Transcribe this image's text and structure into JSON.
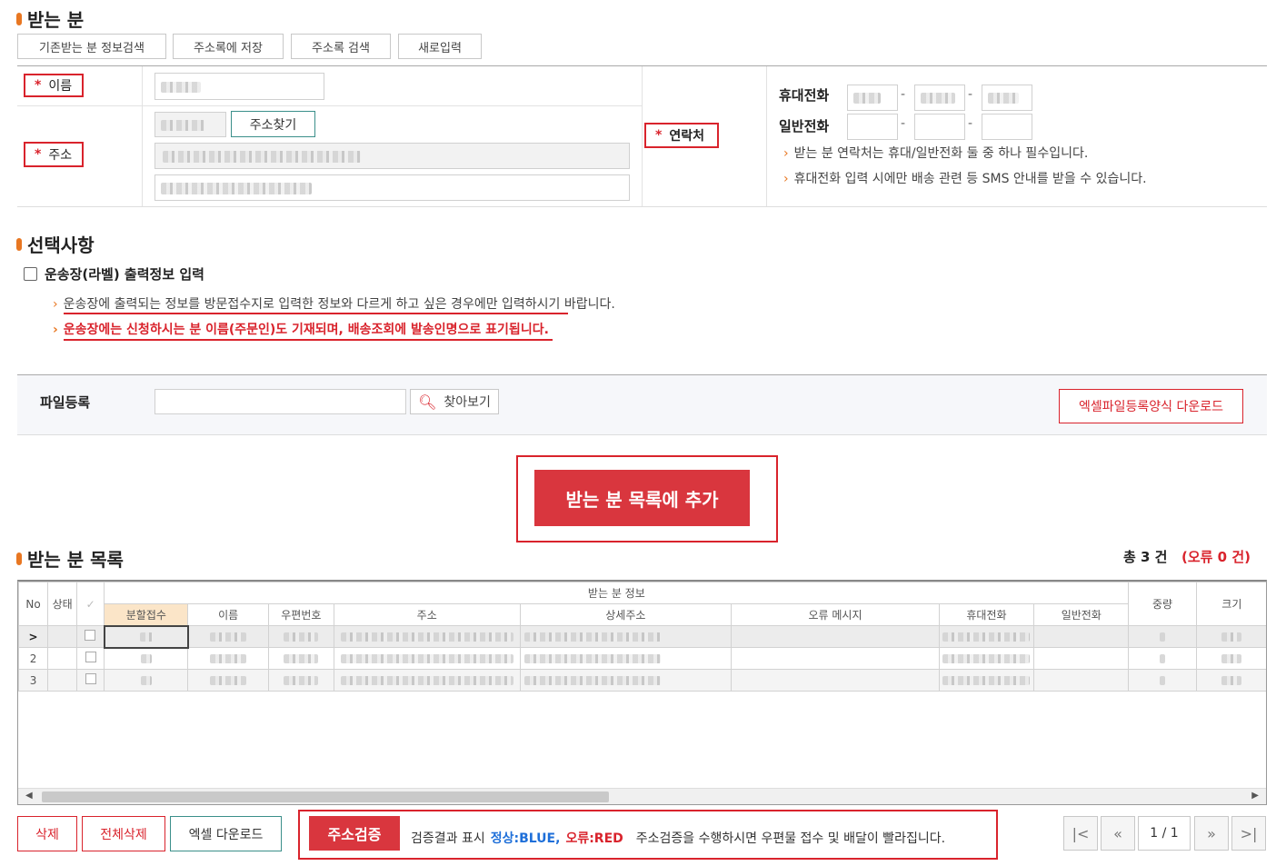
{
  "recipient": {
    "title": "받는 분",
    "buttons": [
      "기존받는 분 정보검색",
      "주소록에 저장",
      "주소록 검색",
      "새로입력"
    ],
    "name_label": "이름",
    "address_label": "주소",
    "address_search_btn": "주소찾기",
    "contact_label": "연락처",
    "mobile_label": "휴대전화",
    "phone_label": "일반전화",
    "dash": "-",
    "notes": [
      "받는 분 연락처는 휴대/일반전화 둘 중 하나 필수입니다.",
      "휴대전화 입력 시에만 배송 관련 등 SMS 안내를 받을 수 있습니다."
    ]
  },
  "options": {
    "title": "선택사항",
    "checkbox_label": "운송장(라벨) 출력정보 입력",
    "notes": [
      "운송장에 출력되는 정보를 방문접수지로 입력한 정보와 다르게 하고 싶은 경우에만 입력하시기 바랍니다.",
      "운송장에는 신청하시는 분 이름(주문인)도 기재되며, 배송조회에 발송인명으로 표기됩니다."
    ]
  },
  "file": {
    "label": "파일등록",
    "browse_btn": "찾아보기",
    "download_template_btn": "엑셀파일등록양식 다운로드"
  },
  "add_button": "받는 분 목록에 추가",
  "list": {
    "title": "받는 분 목록",
    "total": "총 3 건",
    "errors": "(오류 0 건)",
    "group_header": "받는 분 정보",
    "columns": {
      "no": "No",
      "status": "상태",
      "split": "분할접수",
      "name": "이름",
      "zip": "우편번호",
      "address": "주소",
      "detail": "상세주소",
      "error_msg": "오류 메시지",
      "mobile": "휴대전화",
      "phone": "일반전화",
      "weight": "중량",
      "size": "크기"
    },
    "rows": [
      {
        "no": ">"
      },
      {
        "no": "2"
      },
      {
        "no": "3"
      }
    ]
  },
  "footer": {
    "delete_btn": "삭제",
    "delete_all_btn": "전체삭제",
    "excel_download_btn": "엑셀 다운로드",
    "verify_btn": "주소검증",
    "result_label": "검증결과 표시",
    "normal_text": "정상:BLUE,",
    "error_text": "오류:RED",
    "verify_note": "주소검증을 수행하시면 우편물 접수 및 배달이 빨라집니다.",
    "page": "1 / 1"
  },
  "colors": {
    "accent": "#e87722",
    "red": "#d9232c",
    "blue": "#1e6fd9",
    "teal_border": "#3b8f8a"
  }
}
